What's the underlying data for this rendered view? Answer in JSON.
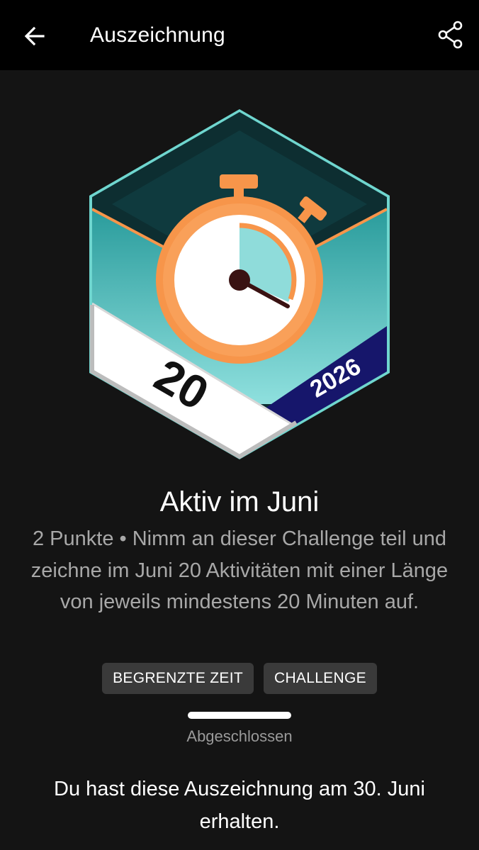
{
  "header": {
    "title": "Auszeichnung",
    "back_icon": "arrow-left-icon",
    "share_icon": "share-icon"
  },
  "badge": {
    "number": "20",
    "year": "2026",
    "icon": "stopwatch-icon",
    "colors": {
      "teal": "#3fc1c0",
      "orange": "#f7954a",
      "navy": "#16166b",
      "white": "#ffffff"
    }
  },
  "award": {
    "name": "Aktiv im Juni",
    "description": "2 Punkte • Nimm an dieser Challenge teil und zeichne im Juni 20 Aktivitäten mit einer Länge von jeweils mindestens 20 Minuten auf."
  },
  "tags": [
    "BEGRENZTE ZEIT",
    "CHALLENGE"
  ],
  "progress": {
    "fraction": 1.0,
    "status": "Abgeschlossen"
  },
  "earned_text": "Du hast diese Auszeichnung am 30. Juni erhalten."
}
